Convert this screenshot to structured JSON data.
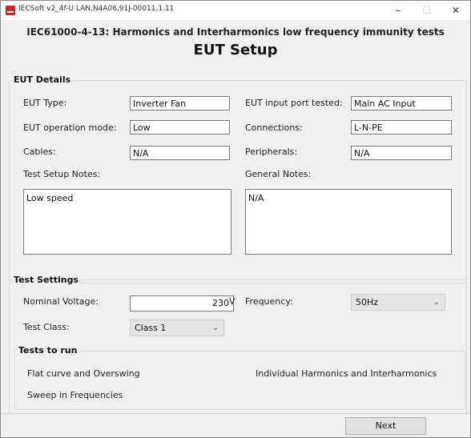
{
  "window": {
    "title": "IECSoft v2_4f-U   LAN,N4A06,91J-00011,1.11",
    "minimize_glyph": "–",
    "maximize_glyph": "☐",
    "close_glyph": "✕"
  },
  "header": {
    "subtitle": "IEC61000-4-13: Harmonics and Interharmonics low frequency immunity tests",
    "title": "EUT Setup"
  },
  "eut_details": {
    "legend": "EUT Details",
    "eut_type_label": "EUT Type:",
    "eut_type_value": "Inverter Fan",
    "input_port_label": "EUT input port tested:",
    "input_port_value": "Main AC Input",
    "operation_mode_label": "EUT operation mode:",
    "operation_mode_value": "Low",
    "connections_label": "Connections:",
    "connections_value": "L-N-PE",
    "cables_label": "Cables:",
    "cables_value": "N/A",
    "peripherals_label": "Peripherals:",
    "peripherals_value": "N/A",
    "setup_notes_label": "Test Setup Notes:",
    "setup_notes_value": "Low speed",
    "general_notes_label": "General Notes:",
    "general_notes_value": "N/A"
  },
  "test_settings": {
    "legend": "Test Settings",
    "nominal_voltage_label": "Nominal Voltage:",
    "nominal_voltage_value": "230",
    "voltage_unit": "V",
    "frequency_label": "Frequency:",
    "frequency_value": "50Hz",
    "test_class_label": "Test Class:",
    "test_class_value": "Class 1"
  },
  "tests_to_run": {
    "legend": "Tests to run",
    "items": [
      "Flat curve and Overswing",
      "Individual Harmonics and Interharmonics",
      "Sweep in Frequencies"
    ]
  },
  "footer": {
    "next_label": "Next"
  },
  "icons": {
    "app": "app-logo-icon",
    "dropdown": "chevron-down-icon"
  },
  "colors": {
    "window_bg": "#f0f0f0",
    "app_icon": "#c62828"
  }
}
